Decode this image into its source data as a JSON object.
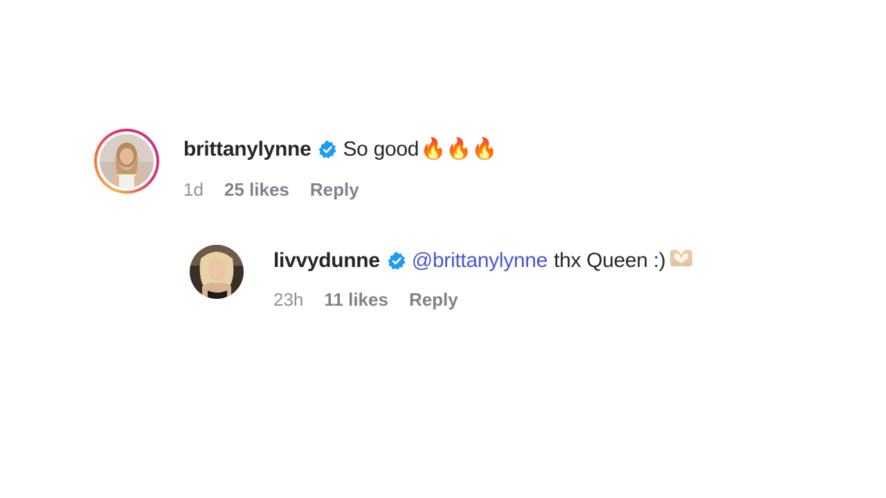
{
  "comments": [
    {
      "username": "brittanylynne",
      "verified": true,
      "text": "So good",
      "emoji": "🔥🔥🔥",
      "age": "1d",
      "likes": "25 likes",
      "reply_label": "Reply"
    },
    {
      "username": "livvydunne",
      "verified": true,
      "mention": "@brittanylynne",
      "text": "thx Queen :)",
      "emoji": "heart-hands",
      "age": "23h",
      "likes": "11 likes",
      "reply_label": "Reply"
    }
  ],
  "colors": {
    "mention": "#4a55d8",
    "verified": "#1f9bf0",
    "meta": "#8e9197"
  }
}
